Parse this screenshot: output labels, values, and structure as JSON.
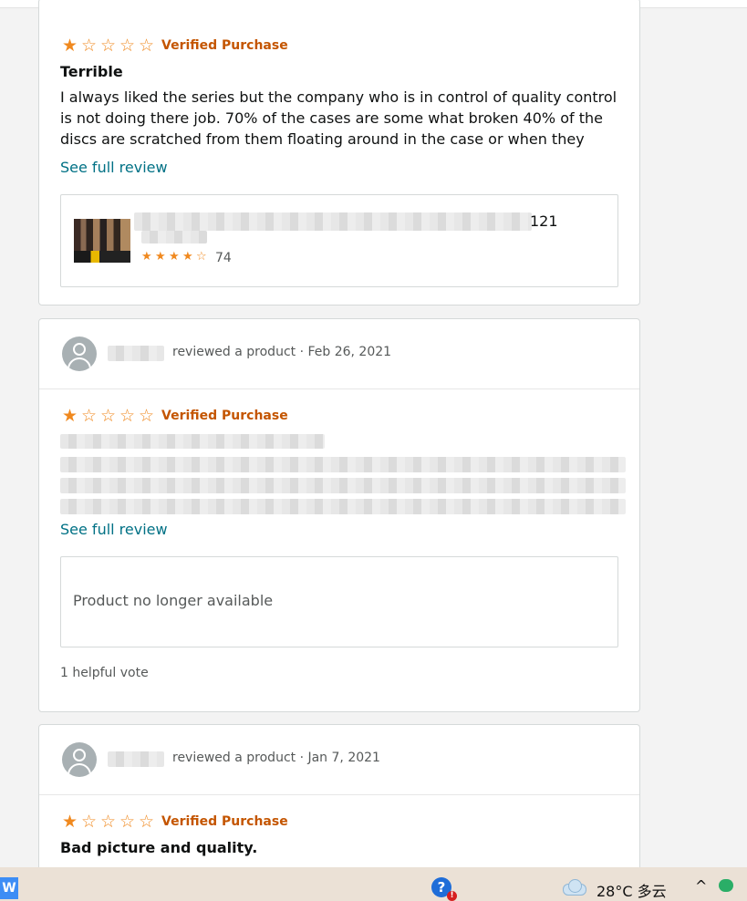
{
  "reviews": [
    {
      "reviewer_meta": "",
      "rating": 1,
      "verified": "Verified Purchase",
      "title": "Terrible",
      "text": "I always liked the series but the company who is in control of quality control is not doing there job. 70% of the cases are some what broken 40% of the discs are scratched from them floating around in the case or when they wh…",
      "see_full": "See full review",
      "product": {
        "title_tail": "121",
        "rating_count": "74",
        "stars": 4.5
      }
    },
    {
      "reviewer_meta": "reviewed a product · Feb 26, 2021",
      "rating": 1,
      "verified": "Verified Purchase",
      "title": "",
      "text": "",
      "see_full": "See full review",
      "product_unavailable": "Product no longer available",
      "helpful": "1 helpful vote"
    },
    {
      "reviewer_meta": "reviewed a product · Jan 7, 2021",
      "rating": 1,
      "verified": "Verified Purchase",
      "title": "Bad picture and quality."
    }
  ],
  "taskbar": {
    "weather_text": "28°C 多云",
    "caret": "^"
  },
  "icons": [
    "star-icon",
    "avatar-icon",
    "help-icon",
    "weather-cloud-icon",
    "wechat-icon",
    "wps-icon"
  ],
  "colors": {
    "star": "#f0891f",
    "verified": "#c45500",
    "link": "#007185"
  }
}
